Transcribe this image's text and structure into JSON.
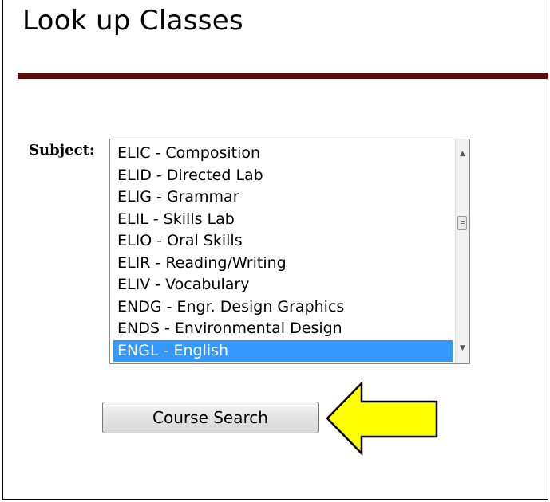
{
  "page": {
    "title": "Look up Classes"
  },
  "form": {
    "subject_label": "Subject:",
    "subject_options": [
      "ELIC - Composition",
      "ELID - Directed Lab",
      "ELIG - Grammar",
      "ELIL - Skills Lab",
      "ELIO - Oral Skills",
      "ELIR - Reading/Writing",
      "ELIV - Vocabulary",
      "ENDG - Engr. Design Graphics",
      "ENDS - Environmental Design",
      "ENGL - English"
    ],
    "selected_option": "ENGL - English",
    "search_button_label": "Course Search"
  },
  "icons": {
    "scroll_up": "scroll-up-arrow-icon",
    "scroll_down": "scroll-down-arrow-icon",
    "pointer_arrow": "yellow-left-arrow-icon"
  },
  "colors": {
    "title_rule": "#5c0b0b",
    "selection": "#3399ff",
    "arrow_fill": "#ffff00",
    "arrow_stroke": "#000000"
  }
}
